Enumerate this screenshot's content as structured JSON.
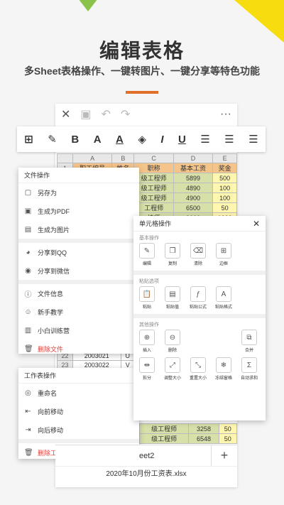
{
  "promo": {
    "title": "编辑表格",
    "subtitle": "多Sheet表格操作、一键转图片、一键分享等特色功能"
  },
  "topbar": {
    "close_icon": "close-icon",
    "save_icon": "save-icon",
    "undo_icon": "undo-icon",
    "redo_icon": "redo-icon",
    "more": "···"
  },
  "toolbar": {
    "bold": "B",
    "font_size": "A",
    "font_color": "A",
    "italic": "I",
    "underline": "U"
  },
  "grid": {
    "columns": [
      "A",
      "B",
      "C",
      "D",
      "E"
    ],
    "header_row": [
      "职工编号",
      "姓名",
      "职称",
      "基本工资",
      "奖金"
    ],
    "rows": [
      {
        "n": "1",
        "cells": [
          "职工编号",
          "姓名",
          "职称",
          "基本工资",
          "奖金"
        ]
      },
      {
        "n": "",
        "cells": [
          "",
          "",
          "级工程师",
          "5899",
          "500"
        ]
      },
      {
        "n": "",
        "cells": [
          "",
          "",
          "级工程师",
          "4890",
          "100"
        ]
      },
      {
        "n": "",
        "cells": [
          "",
          "",
          "级工程师",
          "4900",
          "100"
        ]
      },
      {
        "n": "",
        "cells": [
          "",
          "",
          "工程师",
          "6500",
          "50"
        ]
      },
      {
        "n": "",
        "cells": [
          "",
          "",
          "技师",
          "3600",
          "1000"
        ]
      }
    ],
    "low_rows": [
      {
        "n": "22",
        "cells": [
          "2003021",
          "U"
        ]
      },
      {
        "n": "23",
        "cells": [
          "2003022",
          "V"
        ]
      }
    ],
    "tail_rows": [
      {
        "n": "",
        "cells": [
          "级工程师",
          "3258",
          "50"
        ]
      },
      {
        "n": "",
        "cells": [
          "级工程师",
          "6548",
          "50"
        ]
      }
    ]
  },
  "file_menu": {
    "title": "文件操作",
    "items": [
      {
        "label": "另存为",
        "icon": "save-as-icon"
      },
      {
        "label": "生成为PDF",
        "icon": "pdf-icon"
      },
      {
        "label": "生成为图片",
        "icon": "image-icon"
      },
      {
        "label": "分享到QQ",
        "icon": "qq-icon"
      },
      {
        "label": "分享到微信",
        "icon": "wechat-icon"
      },
      {
        "label": "文件信息",
        "icon": "info-icon"
      },
      {
        "label": "新手教学",
        "icon": "help-icon"
      },
      {
        "label": "小白训练营",
        "icon": "book-icon"
      },
      {
        "label": "删除文件",
        "icon": "trash-icon"
      }
    ]
  },
  "sheet_menu": {
    "title": "工作表操作",
    "items": [
      {
        "label": "重命名",
        "icon": "eye-icon"
      },
      {
        "label": "向前移动",
        "icon": "move-forward-icon"
      },
      {
        "label": "向后移动",
        "icon": "move-back-icon"
      },
      {
        "label": "删除工作表",
        "icon": "trash-icon"
      }
    ]
  },
  "cell_menu": {
    "title": "单元格操作",
    "sections": [
      {
        "name": "基本操作",
        "tiles": [
          "编辑",
          "复制",
          "清除",
          "边框"
        ]
      },
      {
        "name": "粘贴选项",
        "tiles": [
          "粘贴",
          "粘贴值",
          "粘贴公式",
          "粘贴格式"
        ]
      },
      {
        "name": "其他操作",
        "tiles": [
          "插入",
          "删除",
          "合并",
          "拆分",
          "调整大小",
          "重置大小",
          "冻结窗格",
          "自动求和"
        ]
      }
    ]
  },
  "bottom": {
    "sheet_tab": "eet2",
    "add": "+",
    "filename": "2020年10月份工资表.xlsx"
  },
  "colors": {
    "accent_line": "#e07028",
    "header_cell": "#f5c48a",
    "green_cell": "#d6e0a8",
    "yellow_cell": "#fff7b0",
    "delete_red": "#e53935"
  }
}
